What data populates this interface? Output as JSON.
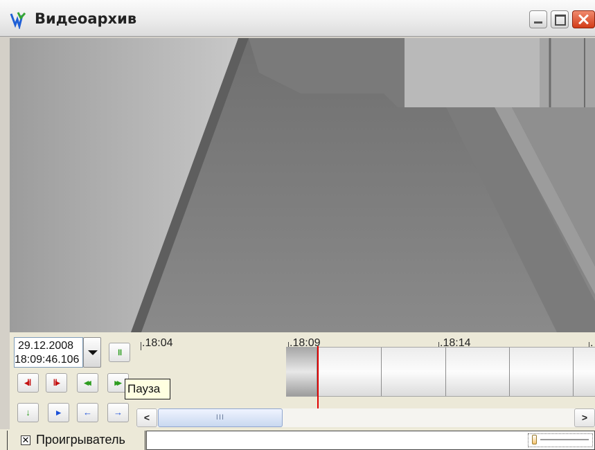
{
  "window": {
    "title": "Видеоархив",
    "icon": "app-logo-icon",
    "controls": [
      "minimize",
      "maximize",
      "close"
    ]
  },
  "datetime": {
    "date": "29.12.2008",
    "time": "18:09:46.106"
  },
  "buttons": {
    "pause": {
      "label": "॥",
      "icon": "pause-icon"
    },
    "frame_back": {
      "label": "◂‖",
      "icon": "frame-back-icon"
    },
    "frame_forward": {
      "label": "‖▸",
      "icon": "frame-forward-icon"
    },
    "play_back": {
      "label": "◂◂",
      "icon": "play-backward-icon"
    },
    "play_forward": {
      "label": "▸▸",
      "icon": "play-forward-icon"
    },
    "nav_down": {
      "label": "↓",
      "icon": "arrow-down-icon"
    },
    "nav_play": {
      "label": "▸",
      "icon": "play-icon"
    },
    "nav_left": {
      "label": "←",
      "icon": "arrow-left-icon"
    },
    "nav_right": {
      "label": "→",
      "icon": "arrow-right-icon"
    }
  },
  "tooltip": "Пауза",
  "timeline": {
    "labels": [
      ".18:04",
      ".18:09",
      ".18:14",
      "."
    ],
    "cursor_time": "18:09:46.106"
  },
  "scrollbar": {
    "left": "<",
    "right": ">",
    "grip": "III"
  },
  "status": {
    "checkbox_mark": "✕",
    "player_label": "Проигрыватель",
    "player_checked": true
  },
  "colors": {
    "transport_red": "#c41212",
    "transport_green": "#2e9d20",
    "nav_blue": "#1b50d8",
    "cursor": "#e00000"
  }
}
